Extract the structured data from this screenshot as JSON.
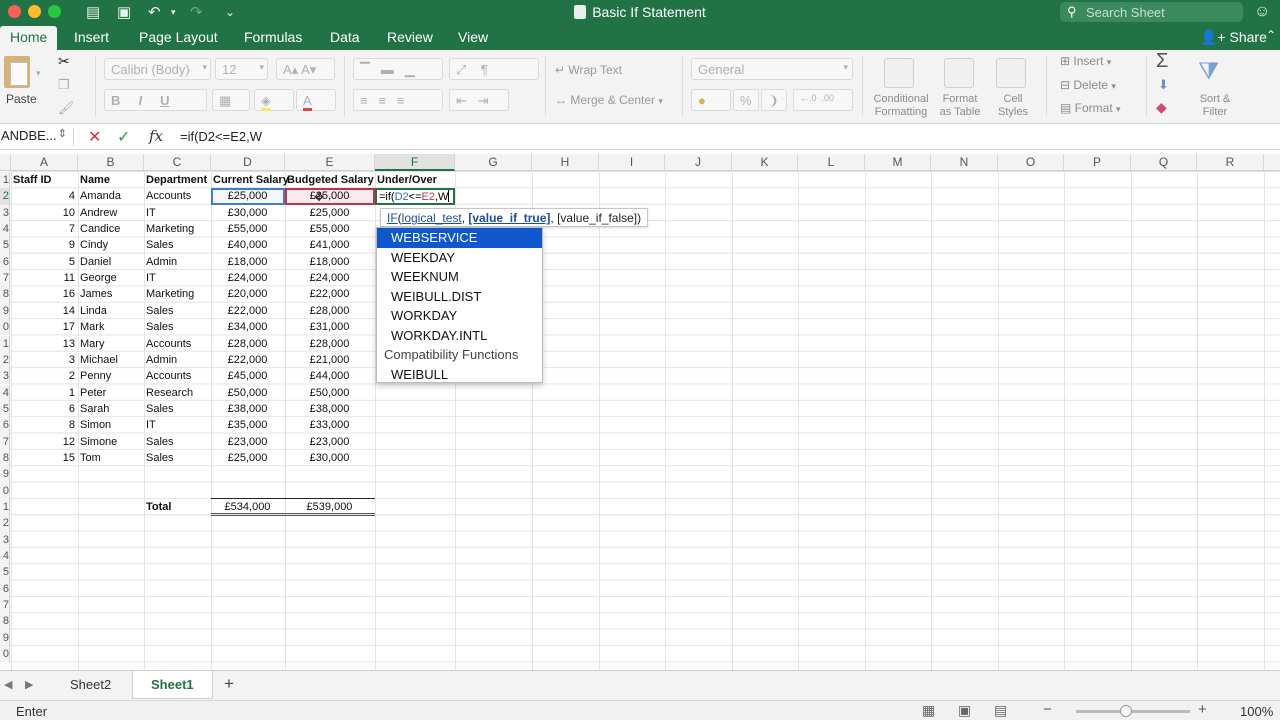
{
  "window": {
    "title": "Basic If Statement",
    "search_placeholder": "Search Sheet"
  },
  "tabs": [
    "Home",
    "Insert",
    "Page Layout",
    "Formulas",
    "Data",
    "Review",
    "View"
  ],
  "share_label": "Share",
  "ribbon": {
    "paste_label": "Paste",
    "font_name": "Calibri (Body)",
    "font_size": "12",
    "wrap_text": "Wrap Text",
    "merge_center": "Merge & Center",
    "number_format": "General",
    "conditional_formatting": [
      "Conditional",
      "Formatting"
    ],
    "format_as_table": [
      "Format",
      "as Table"
    ],
    "cell_styles": [
      "Cell",
      "Styles"
    ],
    "insert": "Insert",
    "delete": "Delete",
    "format": "Format",
    "sort_filter": [
      "Sort &",
      "Filter"
    ]
  },
  "formula_bar": {
    "name_box": "ANDBE...",
    "formula": "=if(D2<=E2,W"
  },
  "columns": [
    "A",
    "B",
    "C",
    "D",
    "E",
    "F",
    "G",
    "H",
    "I",
    "J",
    "K",
    "L",
    "M",
    "N",
    "O",
    "P",
    "Q",
    "R"
  ],
  "row_numbers": [
    "1",
    "2",
    "3",
    "4",
    "5",
    "6",
    "7",
    "8",
    "9",
    "0",
    "1",
    "2",
    "3",
    "4",
    "5",
    "6",
    "7",
    "8",
    "9",
    "0",
    "1",
    "2",
    "3",
    "4",
    "5",
    "6",
    "7",
    "8",
    "9",
    "0"
  ],
  "headers": [
    "Staff ID",
    "Name",
    "Department",
    "Current Salary",
    "Budgeted Salary",
    "Under/Over"
  ],
  "rows": [
    {
      "id": "4",
      "name": "Amanda",
      "dept": "Accounts",
      "current": "£25,000",
      "budget": "£25,000"
    },
    {
      "id": "10",
      "name": "Andrew",
      "dept": "IT",
      "current": "£30,000",
      "budget": "£25,000"
    },
    {
      "id": "7",
      "name": "Candice",
      "dept": "Marketing",
      "current": "£55,000",
      "budget": "£55,000"
    },
    {
      "id": "9",
      "name": "Cindy",
      "dept": "Sales",
      "current": "£40,000",
      "budget": "£41,000"
    },
    {
      "id": "5",
      "name": "Daniel",
      "dept": "Admin",
      "current": "£18,000",
      "budget": "£18,000"
    },
    {
      "id": "11",
      "name": "George",
      "dept": "IT",
      "current": "£24,000",
      "budget": "£24,000"
    },
    {
      "id": "16",
      "name": "James",
      "dept": "Marketing",
      "current": "£20,000",
      "budget": "£22,000"
    },
    {
      "id": "14",
      "name": "Linda",
      "dept": "Sales",
      "current": "£22,000",
      "budget": "£28,000"
    },
    {
      "id": "17",
      "name": "Mark",
      "dept": "Sales",
      "current": "£34,000",
      "budget": "£31,000"
    },
    {
      "id": "13",
      "name": "Mary",
      "dept": "Accounts",
      "current": "£28,000",
      "budget": "£28,000"
    },
    {
      "id": "3",
      "name": "Michael",
      "dept": "Admin",
      "current": "£22,000",
      "budget": "£21,000"
    },
    {
      "id": "2",
      "name": "Penny",
      "dept": "Accounts",
      "current": "£45,000",
      "budget": "£44,000"
    },
    {
      "id": "1",
      "name": "Peter",
      "dept": "Research",
      "current": "£50,000",
      "budget": "£50,000"
    },
    {
      "id": "6",
      "name": "Sarah",
      "dept": "Sales",
      "current": "£38,000",
      "budget": "£38,000"
    },
    {
      "id": "8",
      "name": "Simon",
      "dept": "IT",
      "current": "£35,000",
      "budget": "£33,000"
    },
    {
      "id": "12",
      "name": "Simone",
      "dept": "Sales",
      "current": "£23,000",
      "budget": "£23,000"
    },
    {
      "id": "15",
      "name": "Tom",
      "dept": "Sales",
      "current": "£25,000",
      "budget": "£30,000"
    }
  ],
  "totals": {
    "label": "Total",
    "current": "£534,000",
    "budget": "£539,000"
  },
  "edit_cell": {
    "prefix": "=if(",
    "ref1": "D2",
    "op": "<=",
    "ref2": "E2",
    "suffix": ",W"
  },
  "tooltip": {
    "fn": "IF",
    "arg1": "logical_test",
    "arg2": "[value_if_true]",
    "arg3": "[value_if_false]"
  },
  "autocomplete": {
    "items": [
      "WEBSERVICE",
      "WEEKDAY",
      "WEEKNUM",
      "WEIBULL.DIST",
      "WORKDAY",
      "WORKDAY.INTL"
    ],
    "group_label": "Compatibility Functions",
    "group_items": [
      "WEIBULL"
    ]
  },
  "sheets": [
    "Sheet2",
    "Sheet1"
  ],
  "status": {
    "mode": "Enter",
    "zoom": "100%"
  }
}
